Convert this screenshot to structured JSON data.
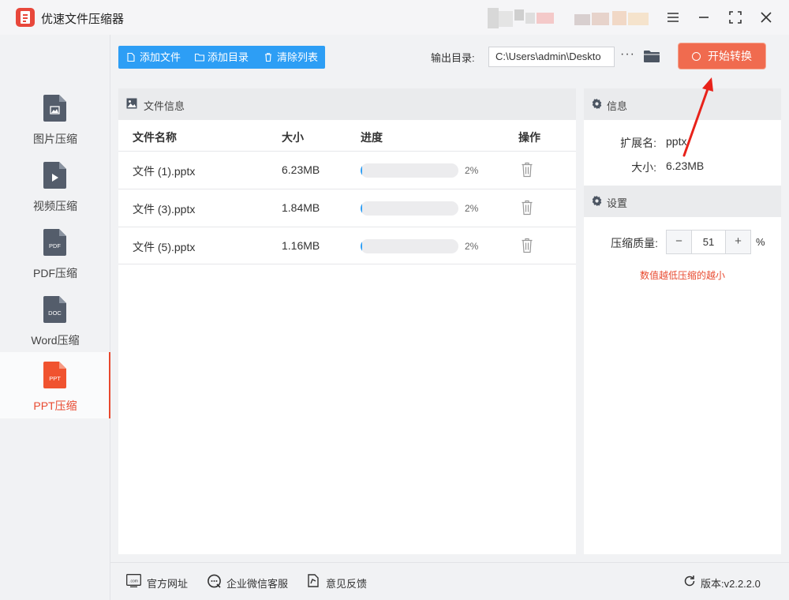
{
  "app": {
    "title": "优速文件压缩器"
  },
  "colors": {
    "accent_blue": "#2d9ef5",
    "accent_red": "#e8492f",
    "start_button": "#f06b4f"
  },
  "window_controls": [
    "menu-icon",
    "minimize-icon",
    "maximize-icon",
    "close-icon"
  ],
  "sidebar": {
    "items": [
      {
        "label": "图片压缩",
        "icon": "image-doc-icon",
        "badge": "",
        "active": false
      },
      {
        "label": "视频压缩",
        "icon": "video-doc-icon",
        "badge": "",
        "active": false
      },
      {
        "label": "PDF压缩",
        "icon": "pdf-doc-icon",
        "badge": "PDF",
        "active": false
      },
      {
        "label": "Word压缩",
        "icon": "doc-doc-icon",
        "badge": "DOC",
        "active": false
      },
      {
        "label": "PPT压缩",
        "icon": "ppt-doc-icon",
        "badge": "PPT",
        "active": true
      }
    ]
  },
  "toolbar": {
    "add_file": "添加文件",
    "add_folder": "添加目录",
    "clear_list": "清除列表",
    "output_label": "输出目录:",
    "output_path": "C:\\Users\\admin\\Deskto",
    "more": "···",
    "start": "开始转换"
  },
  "file_panel": {
    "title": "文件信息",
    "columns": {
      "name": "文件名称",
      "size": "大小",
      "progress": "进度",
      "action": "操作"
    },
    "rows": [
      {
        "name": "文件 (1).pptx",
        "size": "6.23MB",
        "progress": 0.02,
        "progress_text": "2%"
      },
      {
        "name": "文件 (3).pptx",
        "size": "1.84MB",
        "progress": 0.02,
        "progress_text": "2%"
      },
      {
        "name": "文件 (5).pptx",
        "size": "1.16MB",
        "progress": 0.02,
        "progress_text": "2%"
      }
    ]
  },
  "info": {
    "title": "信息",
    "ext_label": "扩展名:",
    "ext_value": "pptx",
    "size_label": "大小:",
    "size_value": "6.23MB"
  },
  "settings": {
    "title": "设置",
    "quality_label": "压缩质量:",
    "minus": "−",
    "plus": "+",
    "quality_value": "51",
    "unit": "%",
    "hint": "数值越低压缩的越小"
  },
  "footer": {
    "website": "官方网址",
    "wechat": "企业微信客服",
    "feedback": "意见反馈",
    "version": "版本:v2.2.2.0"
  }
}
